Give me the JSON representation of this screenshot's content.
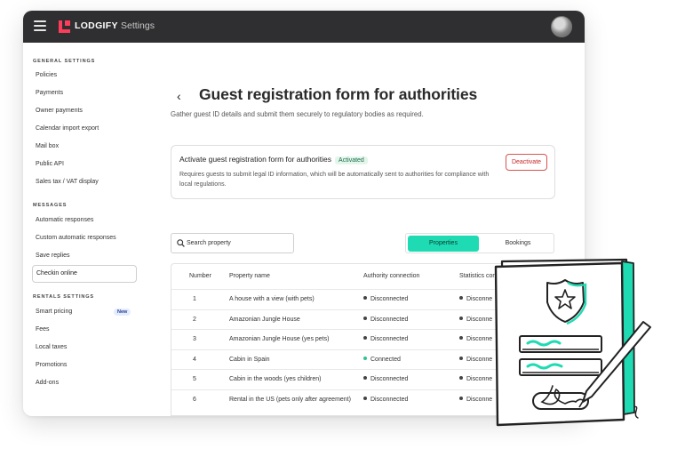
{
  "header": {
    "brand": "LODGIFY",
    "section": "Settings"
  },
  "sidebar": {
    "sections": [
      {
        "heading": "GENERAL SETTINGS",
        "items": [
          "Policies",
          "Payments",
          "Owner payments",
          "Calendar import export",
          "Mail box",
          "Public API",
          "Sales tax / VAT display"
        ]
      },
      {
        "heading": "MESSAGES",
        "items": [
          "Automatic responses",
          "Custom automatic responses",
          "Save replies",
          "Checkin online"
        ]
      },
      {
        "heading": "RENTALS SETTINGS",
        "items": [
          "Smart pricing",
          "Fees",
          "Local taxes",
          "Promotions",
          "Add-ons"
        ]
      }
    ],
    "active_item": "Checkin online",
    "new_badge": "New"
  },
  "page": {
    "title": "Guest registration form for authorities",
    "subtitle": "Gather guest ID details and submit them securely to regulatory bodies as required."
  },
  "card": {
    "title": "Activate guest registration form for authorities",
    "status": "Activated",
    "description": "Requires guests to submit legal ID information, which will be automatically sent to authorities for compliance with local regulations.",
    "button": "Deactivate"
  },
  "search": {
    "placeholder": "Search property"
  },
  "tabs": {
    "active": "Properties",
    "other": "Bookings"
  },
  "table": {
    "columns": [
      "Number",
      "Property name",
      "Authority connection",
      "Statistics con"
    ],
    "rows": [
      {
        "number": "1",
        "name": "A house with a view (with pets)",
        "authority": "Disconnected",
        "stats": "Disconne"
      },
      {
        "number": "2",
        "name": "Amazonian Jungle House",
        "authority": "Disconnected",
        "stats": "Disconne"
      },
      {
        "number": "3",
        "name": "Amazonian Jungle House (yes pets)",
        "authority": "Disconnected",
        "stats": "Disconne"
      },
      {
        "number": "4",
        "name": "Cabin in Spain",
        "authority": "Connected",
        "stats": "Disconne"
      },
      {
        "number": "5",
        "name": "Cabin in the woods (yes children)",
        "authority": "Disconnected",
        "stats": "Disconne"
      },
      {
        "number": "6",
        "name": "Rental in the US (pets only after agreement)",
        "authority": "Disconnected",
        "stats": "Disconne"
      }
    ]
  },
  "colors": {
    "accent": "#1fdbb3",
    "topbar": "#2f2f31",
    "danger": "#d9534f",
    "connected": "#2ec48f",
    "logo": "#ff3d5a"
  },
  "icons": [
    "hamburger-icon",
    "lodgify-logo-icon",
    "avatar",
    "back-chevron-icon",
    "search-icon",
    "status-dot-icon",
    "police-form-illustration"
  ]
}
